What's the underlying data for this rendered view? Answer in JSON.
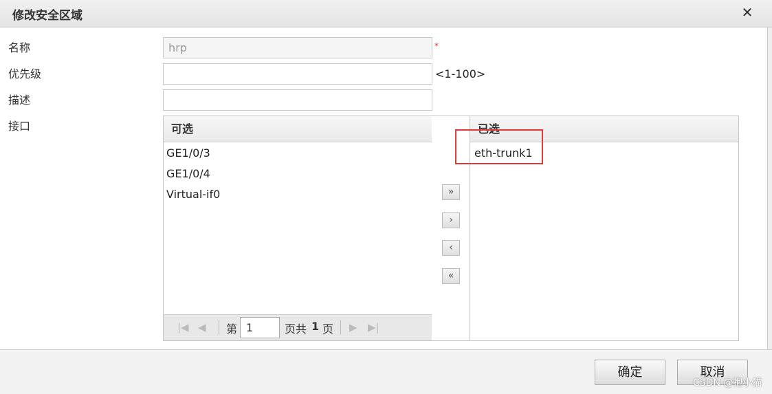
{
  "dialog": {
    "title": "修改安全区域",
    "close_glyph": "✕"
  },
  "form": {
    "name_label": "名称",
    "name_value": "hrp",
    "required_mark": "*",
    "priority_label": "优先级",
    "priority_value": "",
    "priority_hint": "<1-100>",
    "desc_label": "描述",
    "desc_value": "",
    "interface_label": "接口"
  },
  "available": {
    "header": "可选",
    "items": [
      "GE1/0/3",
      "GE1/0/4",
      "Virtual-if0"
    ],
    "pager": {
      "prefix": "第",
      "page": "1",
      "middle": "页共",
      "total": "1",
      "suffix": "页"
    }
  },
  "selected": {
    "header": "已选",
    "items": [
      "eth-trunk1"
    ]
  },
  "transfer_buttons": {
    "add_all": "»",
    "add": "›",
    "remove": "‹",
    "remove_all": "«"
  },
  "footer": {
    "ok_label": "确定",
    "cancel_label": "取消"
  },
  "watermark": "CSDN @抱小猫",
  "colors": {
    "highlight": "#e03a3a",
    "required": "#d33"
  }
}
